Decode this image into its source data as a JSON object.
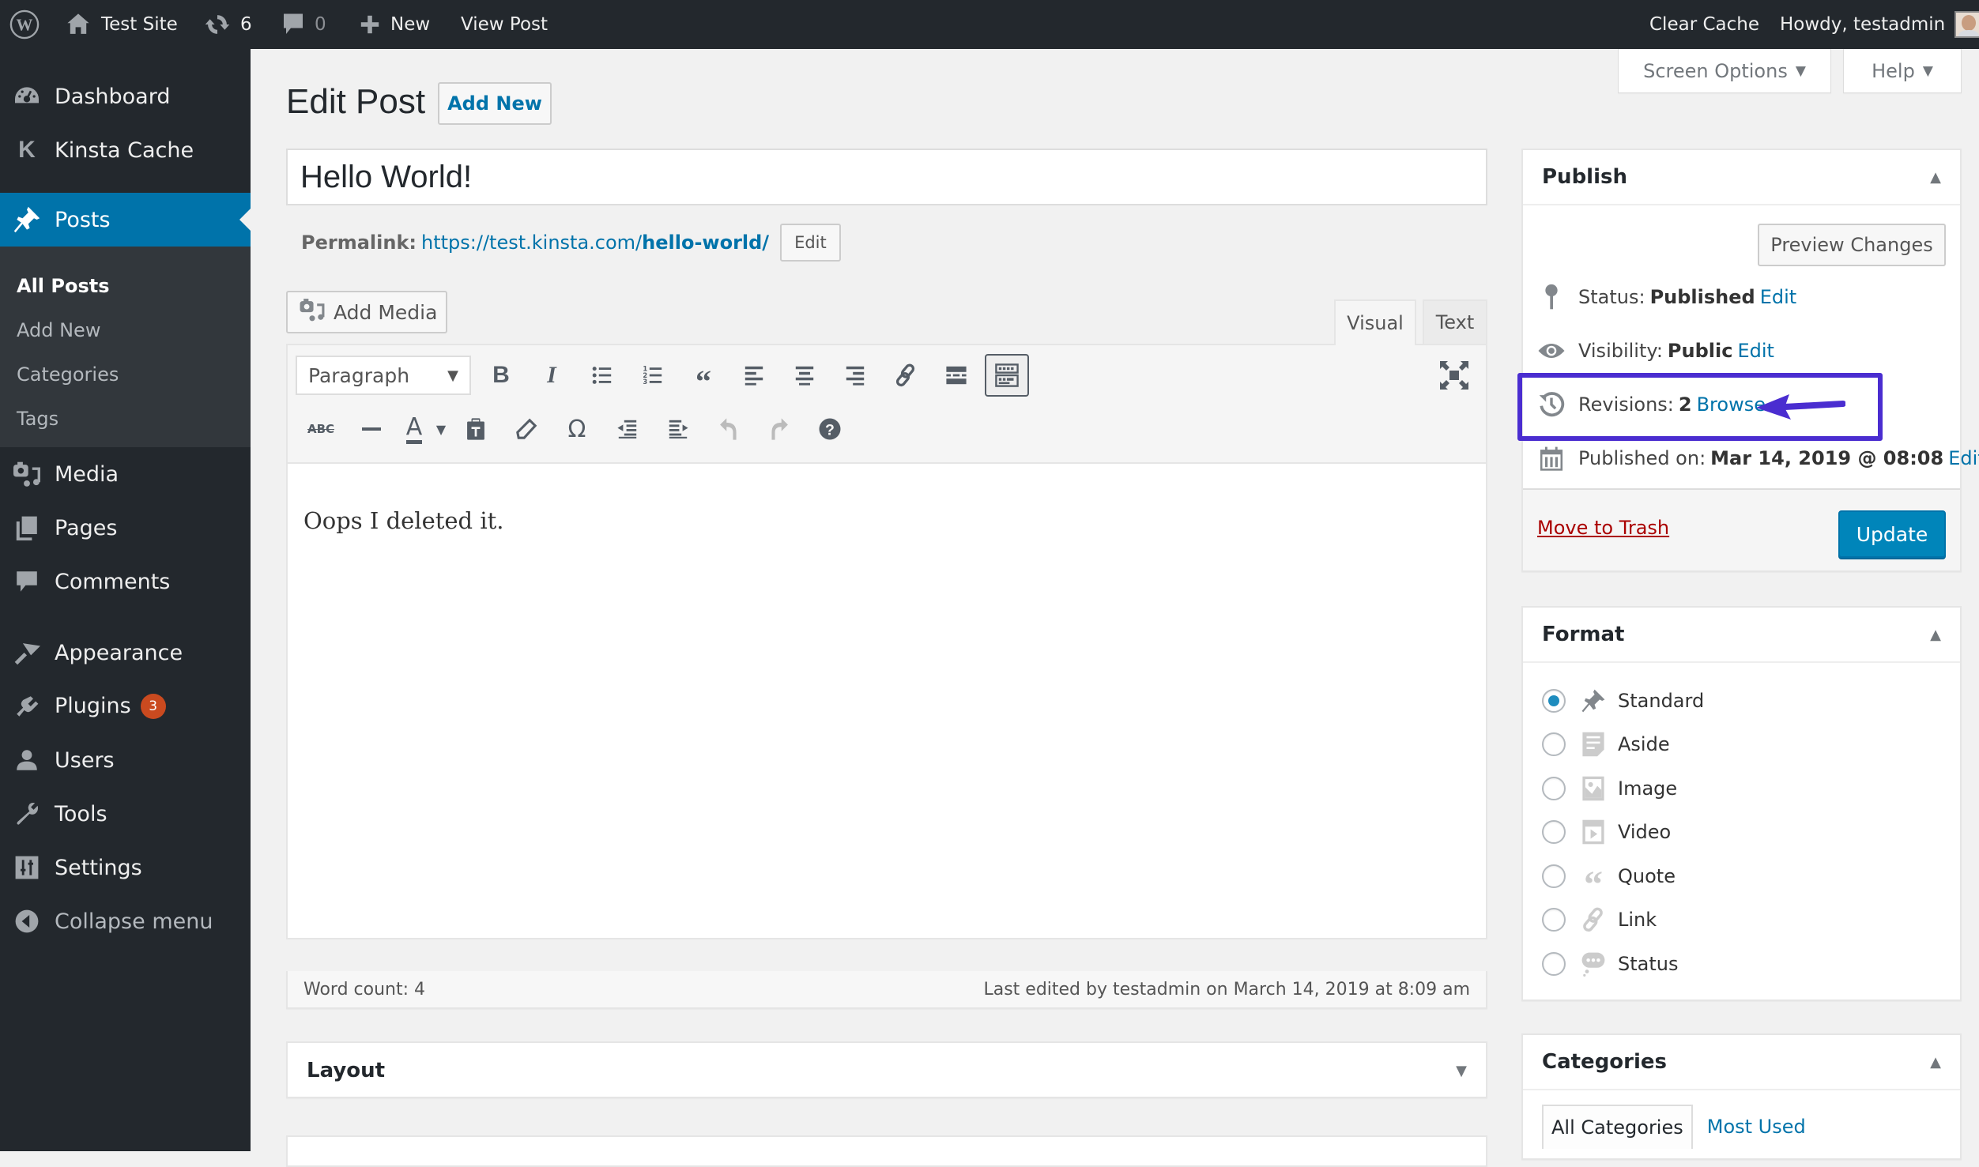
{
  "adminbar": {
    "site_name": "Test Site",
    "updates_count": "6",
    "comments_count": "0",
    "new_label": "New",
    "view_post_label": "View Post",
    "clear_cache_label": "Clear Cache",
    "howdy_label": "Howdy, testadmin",
    "icons": [
      "wordpress-logo-icon",
      "home-icon",
      "updates-icon",
      "comment-icon",
      "plus-icon",
      "avatar"
    ]
  },
  "sidebar": {
    "items": [
      {
        "label": "Dashboard",
        "icon": "dashboard-icon"
      },
      {
        "label": "Kinsta Cache",
        "icon": "kinsta-icon"
      },
      {
        "label": "Posts",
        "icon": "pushpin-icon",
        "current": true
      },
      {
        "label": "Media",
        "icon": "media-icon"
      },
      {
        "label": "Pages",
        "icon": "pages-icon"
      },
      {
        "label": "Comments",
        "icon": "comments-icon"
      },
      {
        "label": "Appearance",
        "icon": "brush-icon"
      },
      {
        "label": "Plugins",
        "icon": "plugin-icon",
        "badge": "3"
      },
      {
        "label": "Users",
        "icon": "user-icon"
      },
      {
        "label": "Tools",
        "icon": "wrench-icon"
      },
      {
        "label": "Settings",
        "icon": "settings-icon"
      },
      {
        "label": "Collapse menu",
        "icon": "collapse-icon"
      }
    ],
    "submenu": [
      {
        "label": "All Posts",
        "current": true
      },
      {
        "label": "Add New"
      },
      {
        "label": "Categories"
      },
      {
        "label": "Tags"
      }
    ]
  },
  "screen_meta": {
    "screen_options_label": "Screen Options",
    "help_label": "Help"
  },
  "main": {
    "page_title": "Edit Post",
    "add_new_label": "Add New",
    "post_title": "Hello World!",
    "permalink_label": "Permalink:",
    "permalink_base": "https://test.kinsta.com/",
    "permalink_slug": "hello-world/",
    "permalink_edit_label": "Edit",
    "add_media_label": "Add Media",
    "editor_tabs": [
      {
        "label": "Visual",
        "active": true
      },
      {
        "label": "Text",
        "active": false
      }
    ],
    "format_select_value": "Paragraph",
    "toolbar_row1": [
      "bold-icon",
      "italic-icon",
      "bullet-list-icon",
      "numbered-list-icon",
      "blockquote-icon",
      "align-left-icon",
      "align-center-icon",
      "align-right-icon",
      "link-icon",
      "read-more-icon",
      "toolbar-toggle-icon"
    ],
    "toolbar_row2": [
      "strikethrough-icon",
      "horizontal-line-icon",
      "text-color-icon",
      "text-color-dropdown-icon",
      "paste-text-icon",
      "clear-formatting-icon",
      "special-character-icon",
      "outdent-icon",
      "indent-icon",
      "undo-icon",
      "redo-icon",
      "help-icon"
    ],
    "editor_content": "Oops I deleted it.",
    "word_count": "Word count: 4",
    "last_edited": "Last edited by testadmin on March 14, 2019 at 8:09 am",
    "layout_box_title": "Layout"
  },
  "publish": {
    "title": "Publish",
    "preview_label": "Preview Changes",
    "status_label": "Status:",
    "status_value": "Published",
    "visibility_label": "Visibility:",
    "visibility_value": "Public",
    "revisions_label": "Revisions:",
    "revisions_value": "2",
    "browse_label": "Browse",
    "published_on_label": "Published on:",
    "published_on_value": "Mar 14, 2019 @ 08:08",
    "edit_label": "Edit",
    "trash_label": "Move to Trash",
    "update_label": "Update",
    "highlight_color": "#4a2dd0"
  },
  "format": {
    "title": "Format",
    "options": [
      {
        "label": "Standard",
        "checked": true,
        "icon": "pushpin-icon"
      },
      {
        "label": "Aside",
        "checked": false,
        "icon": "aside-icon"
      },
      {
        "label": "Image",
        "checked": false,
        "icon": "image-icon"
      },
      {
        "label": "Video",
        "checked": false,
        "icon": "video-icon"
      },
      {
        "label": "Quote",
        "checked": false,
        "icon": "quote-icon"
      },
      {
        "label": "Link",
        "checked": false,
        "icon": "link-icon"
      },
      {
        "label": "Status",
        "checked": false,
        "icon": "status-icon"
      }
    ]
  },
  "categories": {
    "title": "Categories",
    "tabs": [
      {
        "label": "All Categories",
        "active": true
      },
      {
        "label": "Most Used",
        "active": false
      }
    ]
  },
  "colors": {
    "admin_bar": "#23282d",
    "accent": "#0073aa",
    "update_button": "#0085ba",
    "badge": "#ca4a1f",
    "trash": "#aa0000"
  }
}
